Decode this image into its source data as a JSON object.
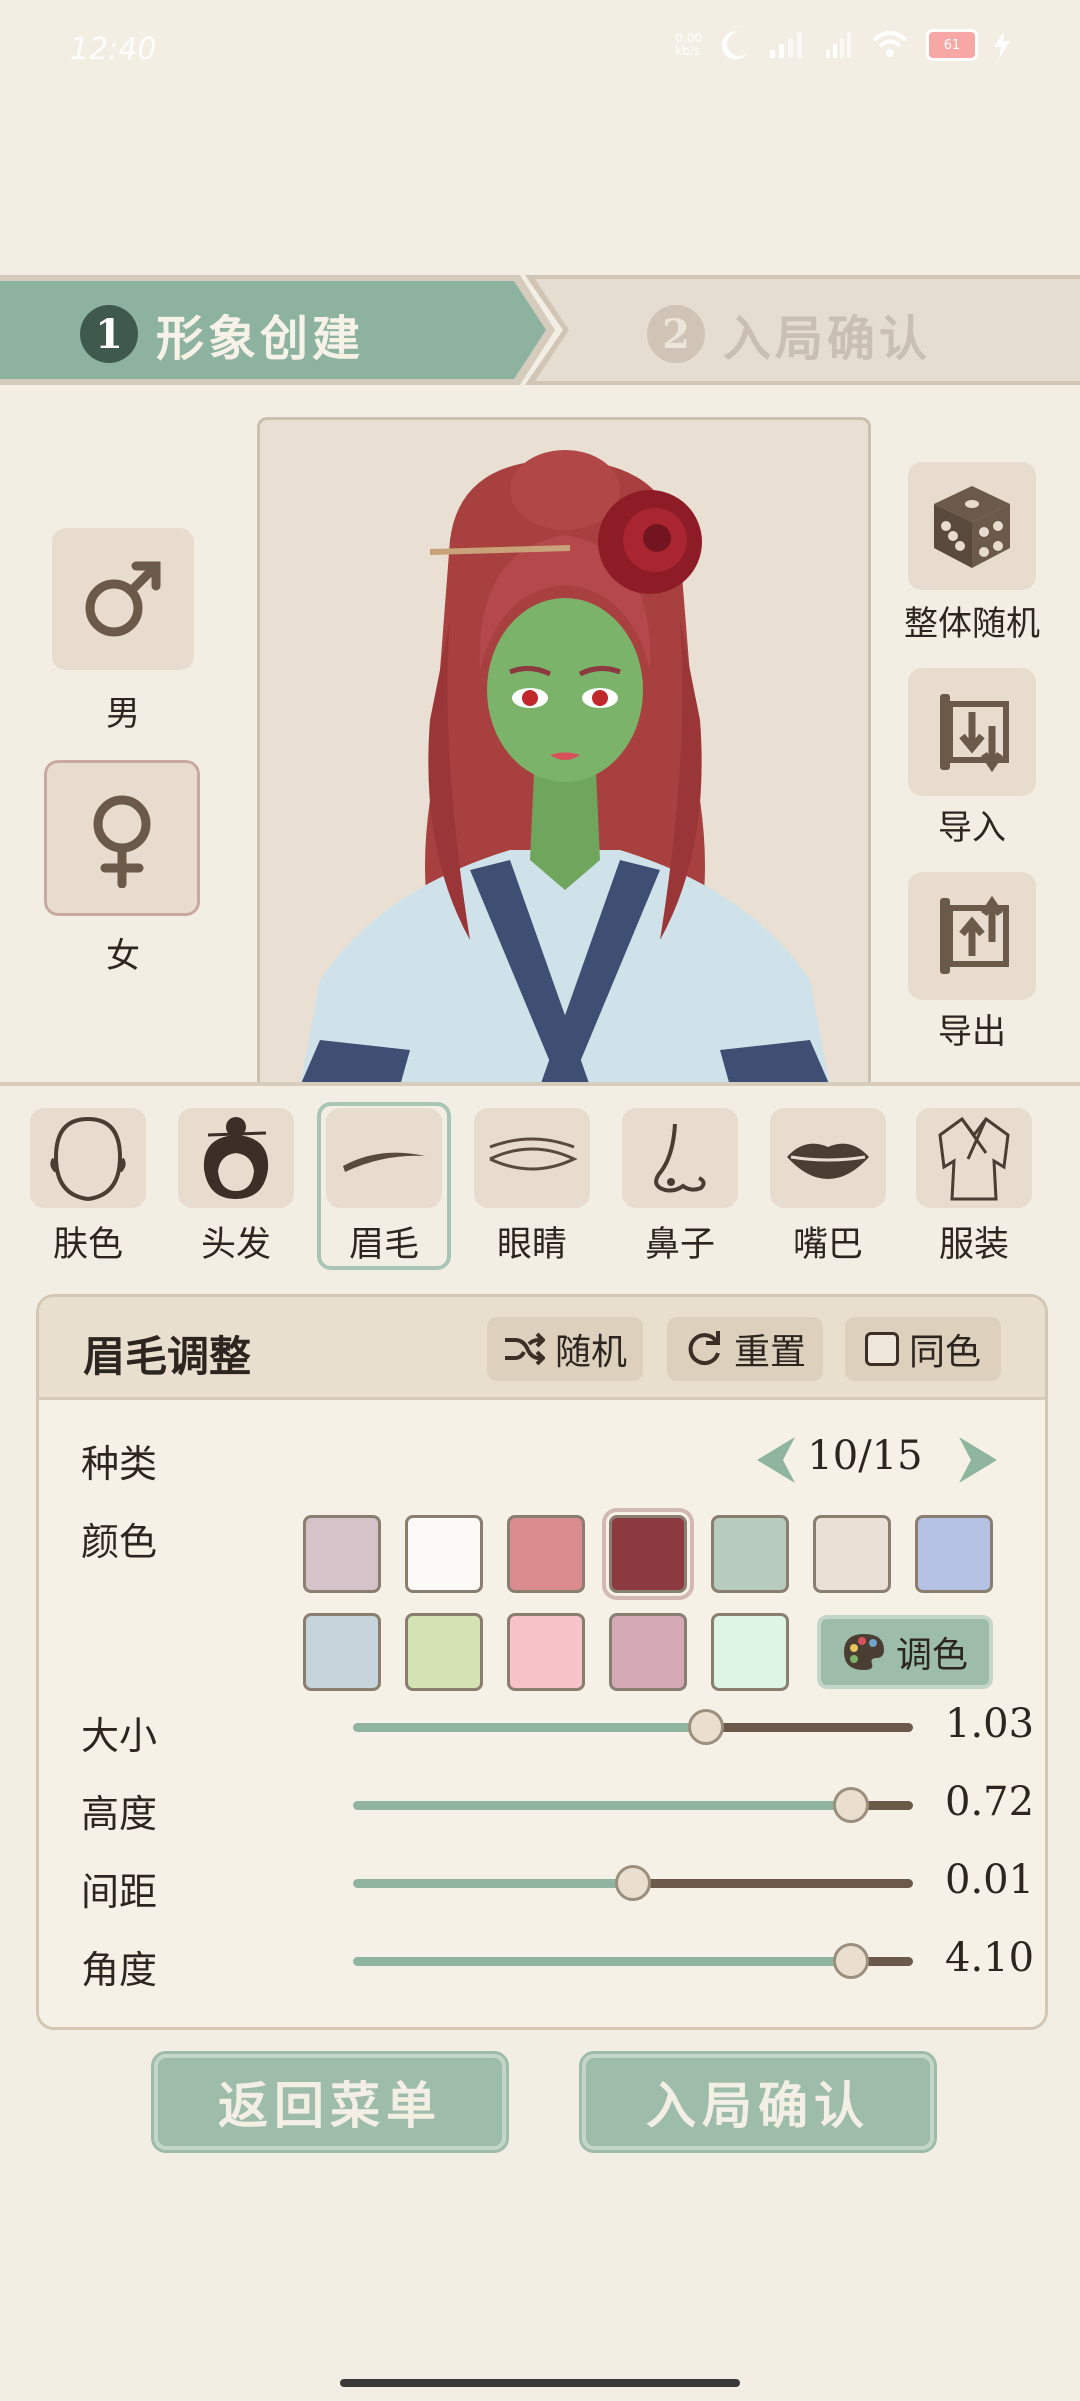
{
  "status": {
    "time": "12:40",
    "net_top": "0.00",
    "net_bottom": "kb/s",
    "battery": "61"
  },
  "steps": [
    {
      "num": "1",
      "label": "形象创建",
      "active": true
    },
    {
      "num": "2",
      "label": "入局确认",
      "active": false
    }
  ],
  "gender": {
    "male": "男",
    "female": "女",
    "selected": "female"
  },
  "actions": {
    "random_all": "整体随机",
    "import": "导入",
    "export": "导出"
  },
  "features": [
    {
      "label": "肤色",
      "icon": "face-outline-icon"
    },
    {
      "label": "头发",
      "icon": "hair-bun-icon"
    },
    {
      "label": "眉毛",
      "icon": "eyebrow-icon",
      "selected": true
    },
    {
      "label": "眼睛",
      "icon": "eye-icon"
    },
    {
      "label": "鼻子",
      "icon": "nose-icon"
    },
    {
      "label": "嘴巴",
      "icon": "lips-icon"
    },
    {
      "label": "服装",
      "icon": "robe-icon"
    }
  ],
  "panel": {
    "title": "眉毛调整",
    "random": "随机",
    "reset": "重置",
    "same_color": "同色",
    "type_label": "种类",
    "type_value": "10/15",
    "color_label": "颜色",
    "palette_label": "调色",
    "colors_row1": [
      "#d6c2c9",
      "#fbfaf7",
      "#db8c8e",
      "#8b3a40",
      "#b7cbbf",
      "#eae0d6",
      "#b6c2e4"
    ],
    "colors_row2": [
      "#c6d4db",
      "#d4e2b4",
      "#f6c3c9",
      "#d5aab6",
      "#ddf6e3"
    ],
    "selected_color": "#8b3a40",
    "sliders": [
      {
        "label": "大小",
        "value": "1.03",
        "fraction": 0.63
      },
      {
        "label": "高度",
        "value": "0.72",
        "fraction": 0.89
      },
      {
        "label": "间距",
        "value": "0.01",
        "fraction": 0.5
      },
      {
        "label": "角度",
        "value": "4.10",
        "fraction": 0.89
      }
    ]
  },
  "bottom": {
    "back": "返回菜单",
    "confirm": "入局确认"
  },
  "colors": {
    "accent": "#8fb5a1",
    "brown": "#6b5a4a",
    "knob": "#eadfce"
  }
}
